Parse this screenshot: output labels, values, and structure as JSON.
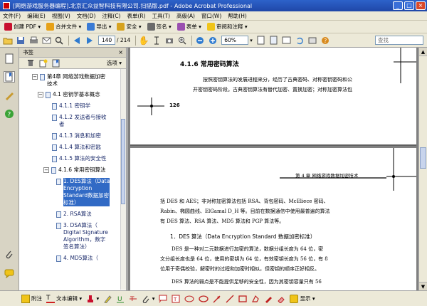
{
  "window": {
    "title": "[网络游戏服务器编程].北京汇众益智科技有限公司.扫描版.pdf - Adobe Acrobat Professional",
    "minimize": "_",
    "maximize": "□",
    "close": "×"
  },
  "menu": [
    "文件(F)",
    "编辑(E)",
    "视图(V)",
    "文档(D)",
    "注释(C)",
    "表单(R)",
    "工具(T)",
    "高级(A)",
    "窗口(W)",
    "帮助(H)"
  ],
  "toolbar1": {
    "create_pdf": "创建 PDF",
    "combine_files": "合并文件",
    "export": "导出",
    "security": "安全",
    "sign": "签名",
    "forms": "表单",
    "review_comment": "审阅和注释"
  },
  "toolbar2": {
    "current_page": "140",
    "total_pages": "/ 214",
    "zoom": "60%",
    "search_placeholder": "查找"
  },
  "bookmarks": {
    "header": "书签",
    "options": "选项",
    "items": [
      {
        "label": "第4章  网络游戏数据加密",
        "label2": "技术",
        "toggle": "−"
      },
      {
        "label": "4.1 密钥学基本概念",
        "toggle": "−"
      },
      {
        "label": "4.1.1 密钥学"
      },
      {
        "label": "4.1.2 发送者与接收",
        "label2": "者"
      },
      {
        "label": "4.1.3 消息和加密"
      },
      {
        "label": "4.1.4 算法和密匙"
      },
      {
        "label": "4.1.5 算法的安全性"
      },
      {
        "label": "4.1.6 常用密钥算法",
        "toggle": "−"
      },
      {
        "label": "1. DES算法（Data",
        "label2": "Encryption",
        "label3": "Standard数据加密",
        "label4": "标准）"
      },
      {
        "label": "2. RSA算法"
      },
      {
        "label": "3. DSA算法（",
        "label2": "Digital Signature",
        "label3": "Algorithm，数字",
        "label4": "签名算法）"
      },
      {
        "label": "4. MD5算法（"
      }
    ]
  },
  "page1": {
    "section_title": "4.1.6   常用密码算法",
    "para_line1": "按照密钥算法的发展进程来分，经历了古典密码、对称密钥密码和公",
    "para_line2": "开密钥密码阶段。古典密钥算法有替代加密、置换加密；对称加密算法包",
    "page_number": "126"
  },
  "page2": {
    "running_header": "第 4 章    网络游戏数据加密技术",
    "line1": "括 DES 和 AES；非对称加密算法包括 RSA、背包密码、McEliece 密码、",
    "line2": "Rabin、椭圆曲线、ElGamal D_H 等。目前在数据通信中使用最普遍的算法",
    "line3": "有 DES 算法、RSA 算法、MD5 算法和 PGP 算法等。",
    "subheading": "1．DES 算法（Data Encryption Standard 数据加密标准）",
    "p2_line1": "DES 是一种对二元数据进行加密的算法，数据分组长度为 64 位，密",
    "p2_line2": "文分组长度也是 64 位，使用的密钥为 64 位，有效密钥长度为 56 位，有 8",
    "p2_line3": "位用于奇偶校验，解密时的过程和加密时相似，但密钥的顺序正好相反。",
    "p3_line1": "DES 算法的弱点是不能提供足够的安全性，因为其密钥容量只有 56"
  },
  "bottombar": {
    "note": "附注",
    "text_edit": "文本编辑",
    "show": "显示"
  }
}
